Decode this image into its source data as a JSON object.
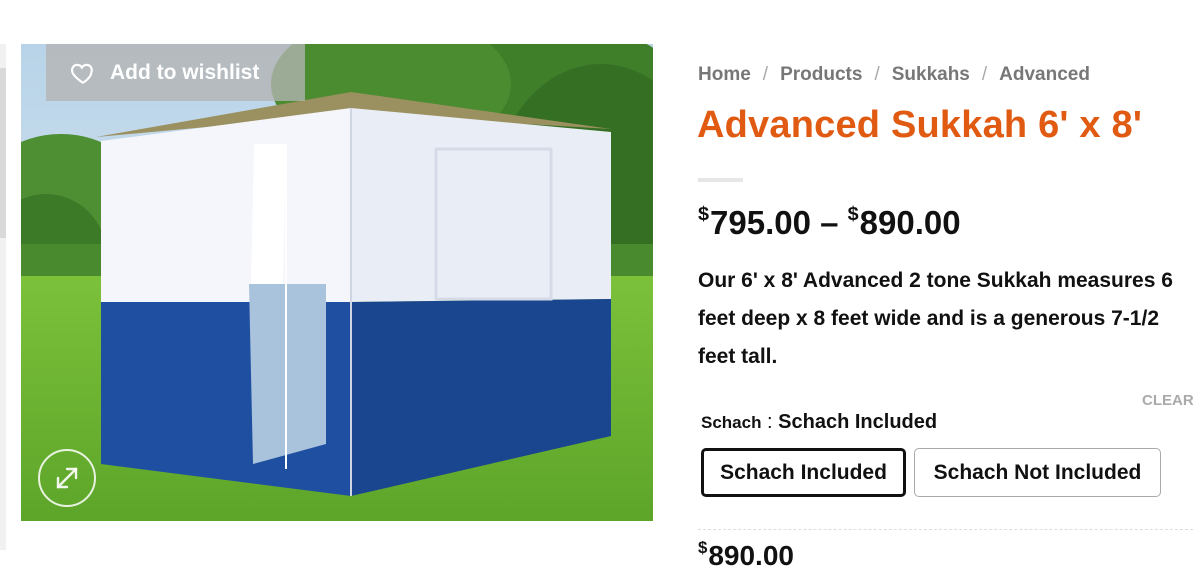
{
  "product": {
    "title": "Advanced Sukkah 6' x 8'",
    "price_range": {
      "currency_symbol": "$",
      "min": "795.00",
      "separator": "–",
      "max": "890.00"
    },
    "description": "Our 6' x 8' Advanced 2 tone Sukkah measures 6 feet deep x 8 feet wide and is a generous 7-1/2 feet tall.",
    "selected_price": {
      "currency_symbol": "$",
      "amount": "890.00"
    }
  },
  "breadcrumb": {
    "items": [
      "Home",
      "Products",
      "Sukkahs",
      "Advanced"
    ],
    "separator": "/"
  },
  "gallery": {
    "wishlist_label": "Add to wishlist",
    "wishlist_icon": "heart-icon",
    "zoom_icon": "expand-arrows-icon"
  },
  "variations": {
    "attribute_name": "Schach",
    "attribute_separator": ":",
    "selected_value": "Schach Included",
    "clear_label": "CLEAR",
    "options": [
      "Schach Included",
      "Schach Not Included"
    ],
    "selected_index": 0
  },
  "colors": {
    "title": "#e05a12",
    "tent_blue": "#1f4fa0",
    "tent_white": "#f4f6fb"
  }
}
